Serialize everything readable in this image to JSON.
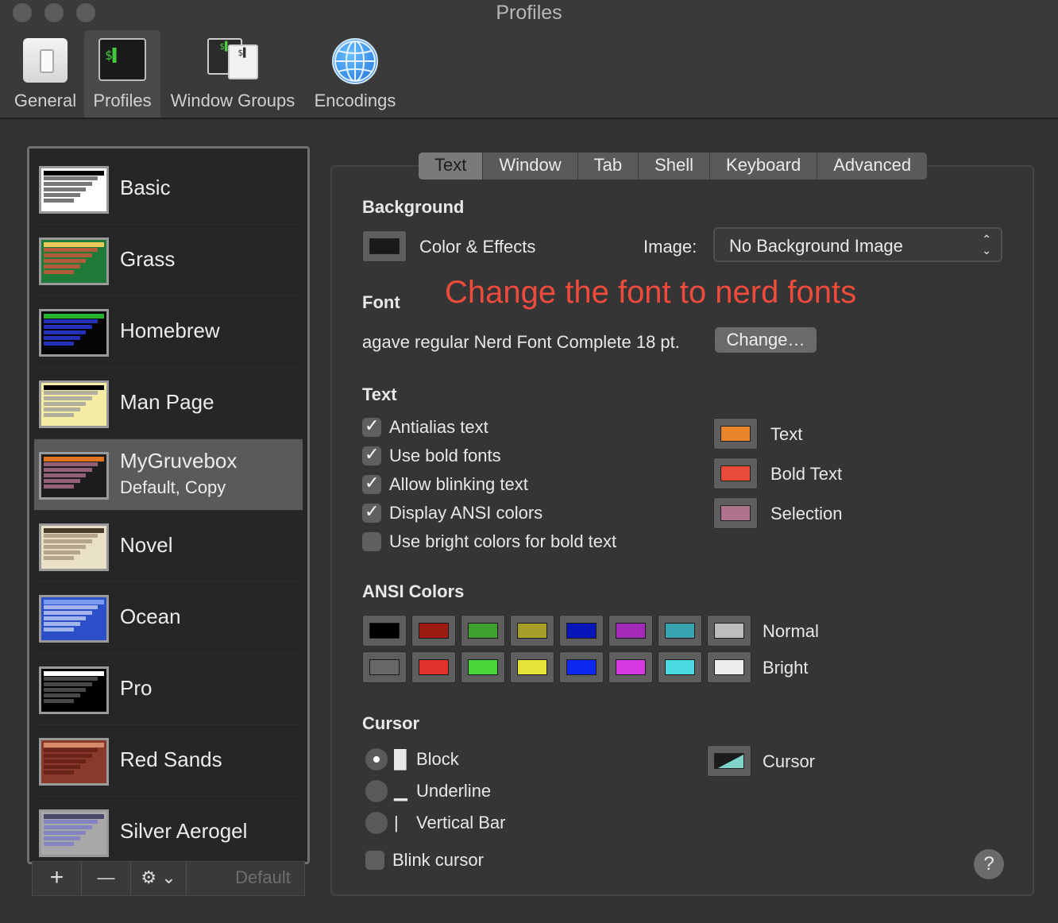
{
  "window": {
    "title": "Profiles"
  },
  "toolbar": [
    {
      "label": "General",
      "icon": "general-switch-icon"
    },
    {
      "label": "Profiles",
      "icon": "terminal-icon",
      "selected": true
    },
    {
      "label": "Window Groups",
      "icon": "window-groups-icon"
    },
    {
      "label": "Encodings",
      "icon": "globe-icon"
    }
  ],
  "terminal_icon_text": "$▌",
  "profiles": [
    {
      "name": "Basic",
      "bg": "#ffffff",
      "head": "#000000",
      "fg": "#555555"
    },
    {
      "name": "Grass",
      "bg": "#1f7a3a",
      "head": "#e9c85c",
      "fg": "#d6553a"
    },
    {
      "name": "Homebrew",
      "bg": "#050505",
      "head": "#24b42d",
      "fg": "#2a3be3"
    },
    {
      "name": "Man Page",
      "bg": "#f5eda3",
      "head": "#000000",
      "fg": "#9e9e9e"
    },
    {
      "name": "MyGruvebox",
      "subtitle": "Default, Copy",
      "bg": "#1d1d1d",
      "head": "#e3751e",
      "fg": "#b0738e",
      "selected": true
    },
    {
      "name": "Novel",
      "bg": "#e9e0c8",
      "head": "#4a3b2b",
      "fg": "#a6967c"
    },
    {
      "name": "Ocean",
      "bg": "#2a4fc8",
      "head": "#7a9cf0",
      "fg": "#c0cdf2"
    },
    {
      "name": "Pro",
      "bg": "#000000",
      "head": "#ffffff",
      "fg": "#5a5a5a"
    },
    {
      "name": "Red Sands",
      "bg": "#8a3a2a",
      "head": "#d88a6a",
      "fg": "#5f1f14"
    },
    {
      "name": "Silver Aerogel",
      "bg": "#a8a8a8",
      "head": "#4a4a6a",
      "fg": "#7a7ac8"
    }
  ],
  "list_bar": {
    "add": "+",
    "remove": "—",
    "gear": "⚙︎ ⌄",
    "default": "Default"
  },
  "tabs": [
    {
      "label": "Text",
      "selected": true
    },
    {
      "label": "Window"
    },
    {
      "label": "Tab"
    },
    {
      "label": "Shell"
    },
    {
      "label": "Keyboard"
    },
    {
      "label": "Advanced"
    }
  ],
  "background": {
    "heading": "Background",
    "color_label": "Color & Effects",
    "color": "#1a1a1a",
    "image_label": "Image:",
    "image_value": "No Background Image"
  },
  "annotation": "Change the font to nerd fonts",
  "font": {
    "heading": "Font",
    "value": "agave regular Nerd Font Complete 18 pt.",
    "change_label": "Change…"
  },
  "text_section": {
    "heading": "Text",
    "checkboxes": [
      {
        "label": "Antialias text",
        "checked": true
      },
      {
        "label": "Use bold fonts",
        "checked": true
      },
      {
        "label": "Allow blinking text",
        "checked": true
      },
      {
        "label": "Display ANSI colors",
        "checked": true
      },
      {
        "label": "Use bright colors for bold text",
        "checked": false
      }
    ],
    "colors": [
      {
        "label": "Text",
        "color": "#e8842a"
      },
      {
        "label": "Bold Text",
        "color": "#e84a3c"
      },
      {
        "label": "Selection",
        "color": "#b0738e"
      }
    ]
  },
  "ansi": {
    "heading": "ANSI Colors",
    "normal_label": "Normal",
    "bright_label": "Bright",
    "normal": [
      "#000000",
      "#9e1b12",
      "#3fa02f",
      "#a6a02b",
      "#0716b8",
      "#a42ab8",
      "#3aa3b0",
      "#bdbdbd"
    ],
    "bright": [
      "#686868",
      "#e0312a",
      "#4ad53a",
      "#e6e23c",
      "#0c28f2",
      "#d43ae0",
      "#49dbe0",
      "#eeeeee"
    ]
  },
  "cursor": {
    "heading": "Cursor",
    "options": [
      {
        "label": "Block",
        "glyph": "█",
        "selected": true
      },
      {
        "label": "Underline",
        "glyph": "▁",
        "selected": false
      },
      {
        "label": "Vertical Bar",
        "glyph": "|",
        "selected": false
      }
    ],
    "blink_label": "Blink cursor",
    "blink_checked": false,
    "color_label": "Cursor",
    "color": "#7fd3c8"
  },
  "help": "?"
}
